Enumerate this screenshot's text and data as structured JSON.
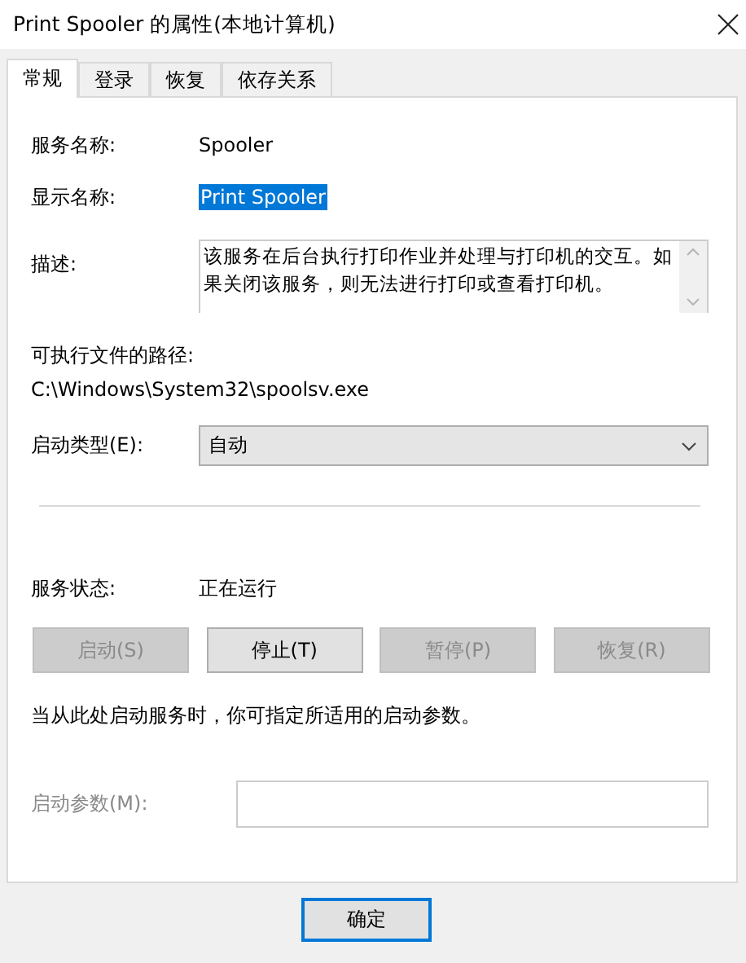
{
  "window": {
    "title": "Print Spooler 的属性(本地计算机)"
  },
  "tabs": [
    {
      "label": "常规",
      "selected": true
    },
    {
      "label": "登录",
      "selected": false
    },
    {
      "label": "恢复",
      "selected": false
    },
    {
      "label": "依存关系",
      "selected": false
    }
  ],
  "service_name": {
    "label": "服务名称:",
    "value": "Spooler"
  },
  "display_name": {
    "label": "显示名称:",
    "value": "Print Spooler",
    "selected": true
  },
  "description": {
    "label": "描述:",
    "value": "该服务在后台执行打印作业并处理与打印机的交互。如果关闭该服务，则无法进行打印或查看打印机。"
  },
  "executable_path": {
    "label": "可执行文件的路径:",
    "value": "C:\\Windows\\System32\\spoolsv.exe"
  },
  "startup_type": {
    "label": "启动类型(E):",
    "value": "自动"
  },
  "service_status": {
    "label": "服务状态:",
    "value": "正在运行"
  },
  "control_buttons": [
    {
      "label": "启动(S)",
      "disabled": true
    },
    {
      "label": "停止(T)",
      "disabled": false
    },
    {
      "label": "暂停(P)",
      "disabled": true
    },
    {
      "label": "恢复(R)",
      "disabled": true
    }
  ],
  "hint": "当从此处启动服务时，你可指定所适用的启动参数。",
  "start_parameters": {
    "label": "启动参数(M):",
    "disabled": true
  },
  "dialog_buttons": [
    {
      "label": "确定",
      "focused": true
    }
  ]
}
